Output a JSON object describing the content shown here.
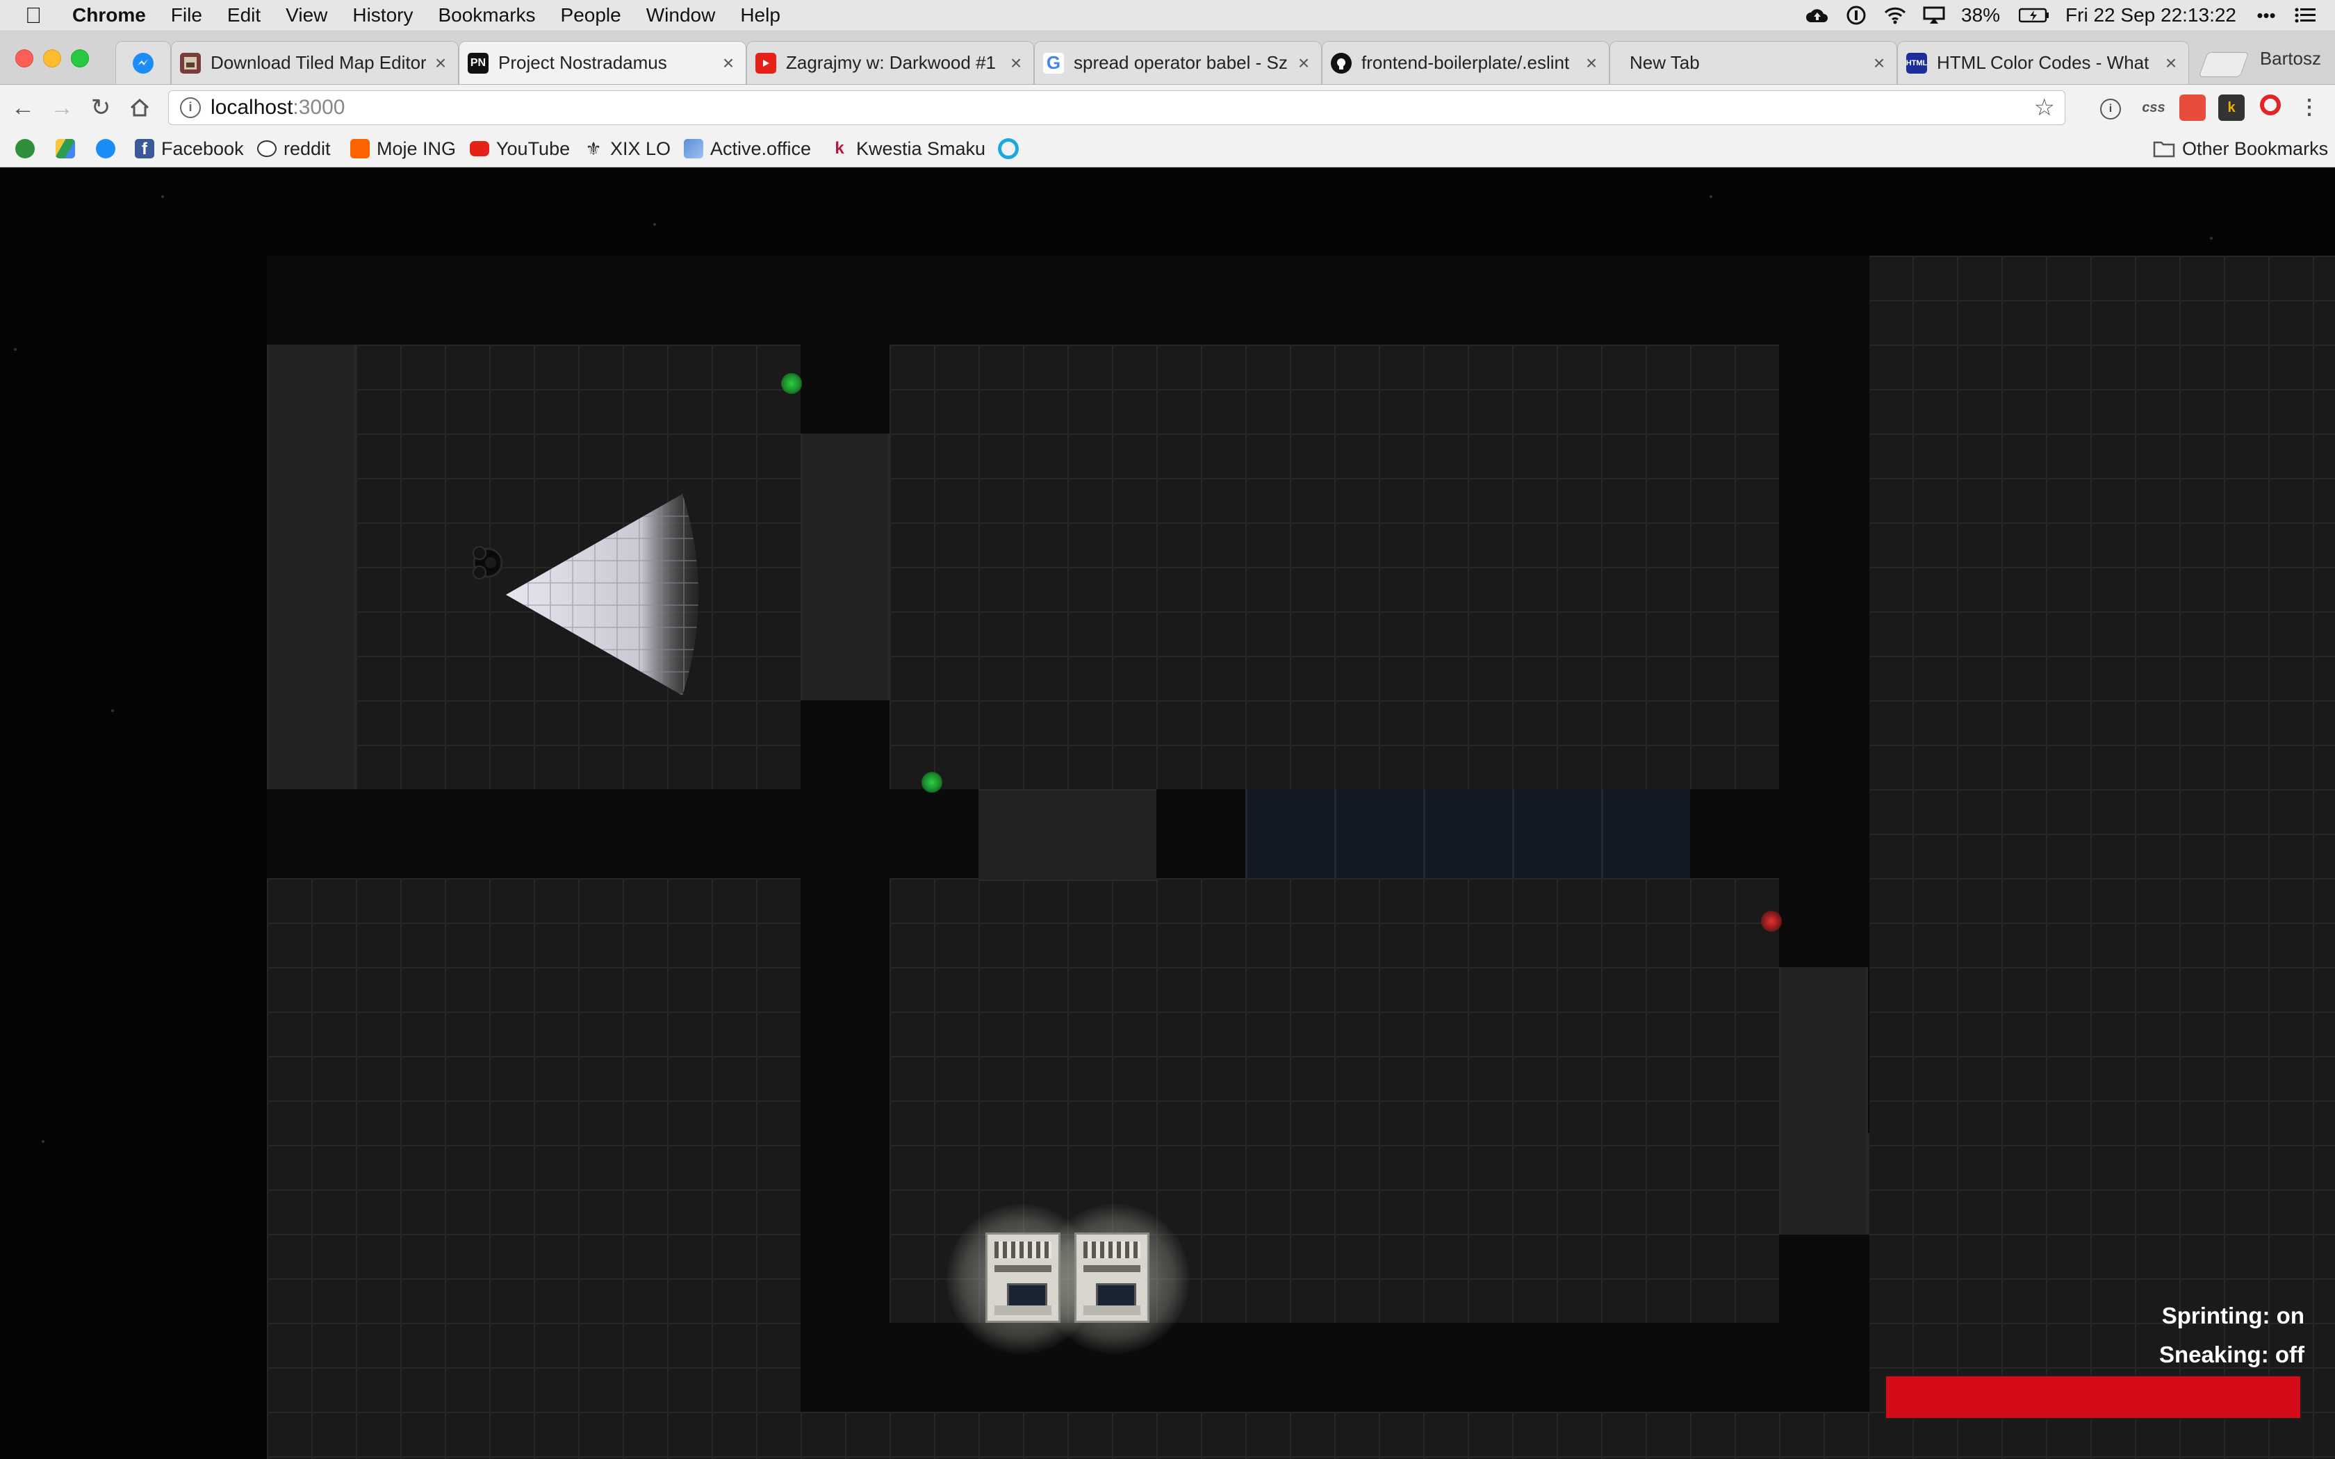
{
  "menubar": {
    "app": "Chrome",
    "items": [
      "File",
      "Edit",
      "View",
      "History",
      "Bookmarks",
      "People",
      "Window",
      "Help"
    ],
    "battery": "38%",
    "clock": "Fri 22 Sep  22:13:22"
  },
  "tabs": [
    {
      "title": "Download Tiled Map Editor",
      "icon": "tiled-icon",
      "active": false
    },
    {
      "title": "Project Nostradamus",
      "icon": "pn-icon",
      "active": true
    },
    {
      "title": "Zagrajmy w: Darkwood #1",
      "icon": "youtube-icon",
      "active": false
    },
    {
      "title": "spread operator babel - Sz",
      "icon": "google-icon",
      "active": false
    },
    {
      "title": "frontend-boilerplate/.eslint",
      "icon": "github-icon",
      "active": false
    },
    {
      "title": "New Tab",
      "icon": "",
      "active": false
    },
    {
      "title": "HTML Color Codes - What",
      "icon": "colorcodes-icon",
      "active": false
    }
  ],
  "profile": "Bartosz",
  "address": {
    "host": "localhost",
    "port": ":3000"
  },
  "bookmarks": [
    {
      "label": "",
      "icon": "sheets-icon"
    },
    {
      "label": "",
      "icon": "drive-icon"
    },
    {
      "label": "",
      "icon": "messenger-icon"
    },
    {
      "label": "Facebook",
      "icon": "facebook-icon"
    },
    {
      "label": "reddit",
      "icon": "reddit-icon"
    },
    {
      "label": "Moje ING",
      "icon": "ing-icon"
    },
    {
      "label": "YouTube",
      "icon": "youtube-icon"
    },
    {
      "label": "XIX LO",
      "icon": "xixlo-icon"
    },
    {
      "label": "Active.office",
      "icon": "activeoffice-icon"
    },
    {
      "label": "Kwestia Smaku",
      "icon": "kwestia-icon"
    },
    {
      "label": "",
      "icon": "circle-icon"
    }
  ],
  "other_bookmarks": "Other Bookmarks",
  "hud": {
    "sprinting": "Sprinting: on",
    "sneaking": "Sneaking: off",
    "stamina_fraction": 1.0,
    "stamina_color": "#d40b18"
  },
  "colors": {
    "marker_green": "#2fcf44",
    "marker_red": "#e23333"
  }
}
